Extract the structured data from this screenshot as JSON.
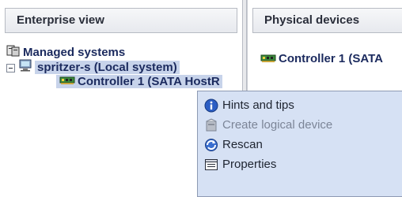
{
  "left_panel": {
    "header": "Enterprise view",
    "tree": {
      "root": "Managed systems",
      "system": "spritzer-s (Local system)",
      "controller": "Controller 1 (SATA HostR"
    }
  },
  "right_panel": {
    "header": "Physical devices",
    "item": "Controller 1 (SATA"
  },
  "context_menu": {
    "items": [
      {
        "label": "Hints and tips",
        "icon": "info-icon",
        "enabled": true
      },
      {
        "label": "Create logical device",
        "icon": "create-icon",
        "enabled": false
      },
      {
        "label": "Rescan",
        "icon": "rescan-icon",
        "enabled": true
      },
      {
        "label": "Properties",
        "icon": "properties-icon",
        "enabled": true
      }
    ]
  },
  "colors": {
    "selection": "#c7d3ea",
    "menu_bg": "#d6e1f4",
    "tree_text": "#1b2a5e"
  }
}
